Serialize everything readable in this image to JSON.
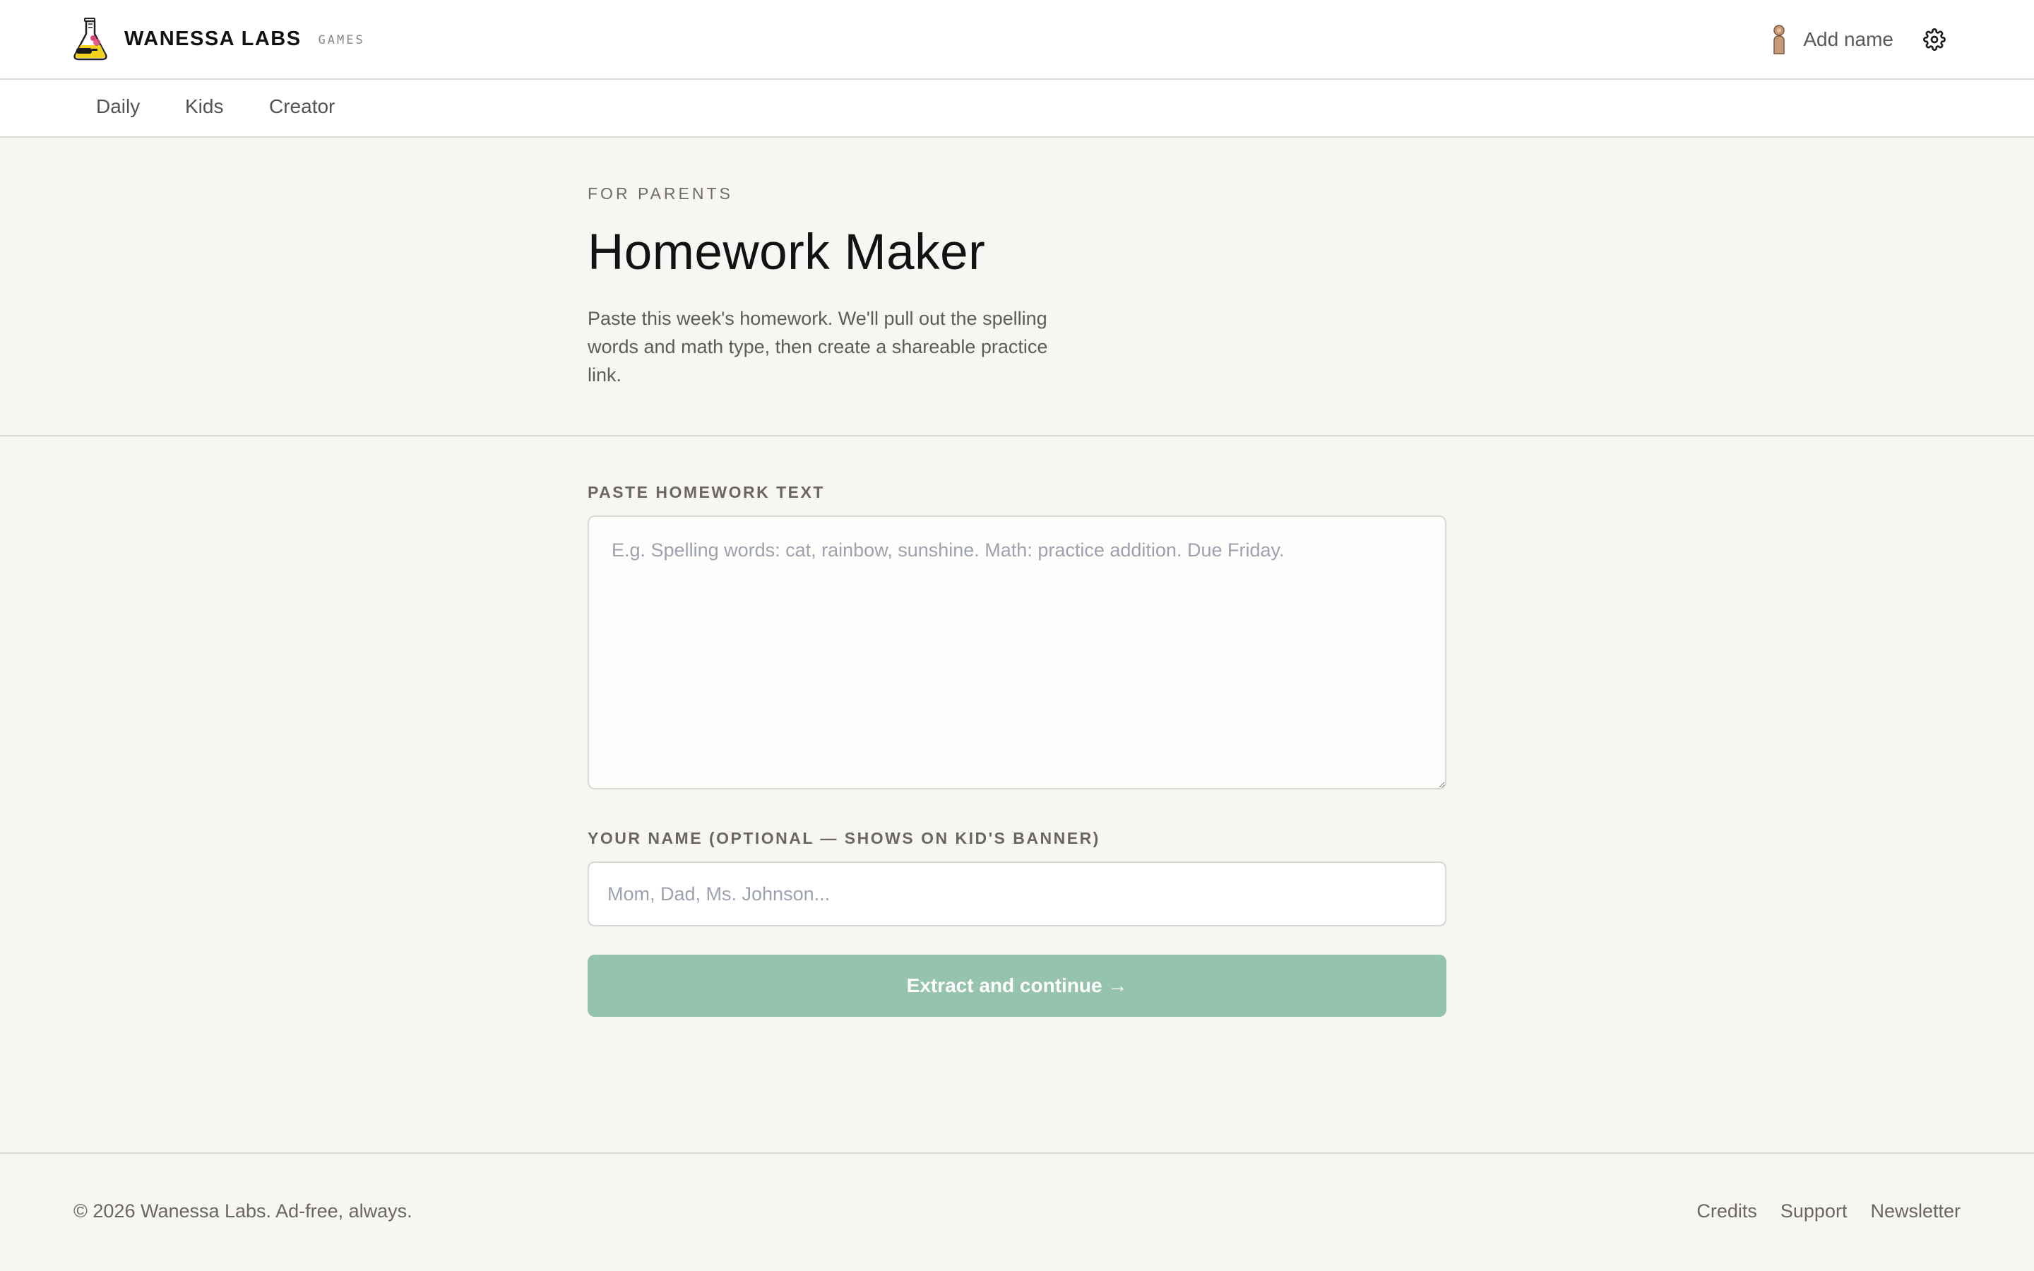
{
  "header": {
    "brand_name": "WANESSA LABS",
    "brand_sub": "GAMES",
    "logo_icon": "flask-mascot-logo",
    "user_icon": "person-figure-icon",
    "user_label": "Add name",
    "settings_icon": "gear-icon"
  },
  "nav": {
    "items": [
      {
        "label": "Daily"
      },
      {
        "label": "Kids"
      },
      {
        "label": "Creator"
      }
    ]
  },
  "hero": {
    "eyebrow": "FOR PARENTS",
    "title": "Homework Maker",
    "description": "Paste this week's homework. We'll pull out the spelling words and math type, then create a shareable practice link."
  },
  "form": {
    "homework_label": "PASTE HOMEWORK TEXT",
    "homework_value": "",
    "homework_placeholder": "E.g. Spelling words: cat, rainbow, sunshine. Math: practice addition. Due Friday.",
    "name_label": "YOUR NAME (OPTIONAL — SHOWS ON KID'S BANNER)",
    "name_value": "",
    "name_placeholder": "Mom, Dad, Ms. Johnson...",
    "submit_label": "Extract and continue →"
  },
  "footer": {
    "copyright": "© 2026 Wanessa Labs. Ad-free, always.",
    "links": [
      {
        "label": "Credits"
      },
      {
        "label": "Support"
      },
      {
        "label": "Newsletter"
      }
    ]
  },
  "colors": {
    "page_bg": "#f8f6f2",
    "surface": "#ffffff",
    "accent_button": "#95c3ad",
    "border": "#dcdad5",
    "muted_text": "#6a6763"
  }
}
